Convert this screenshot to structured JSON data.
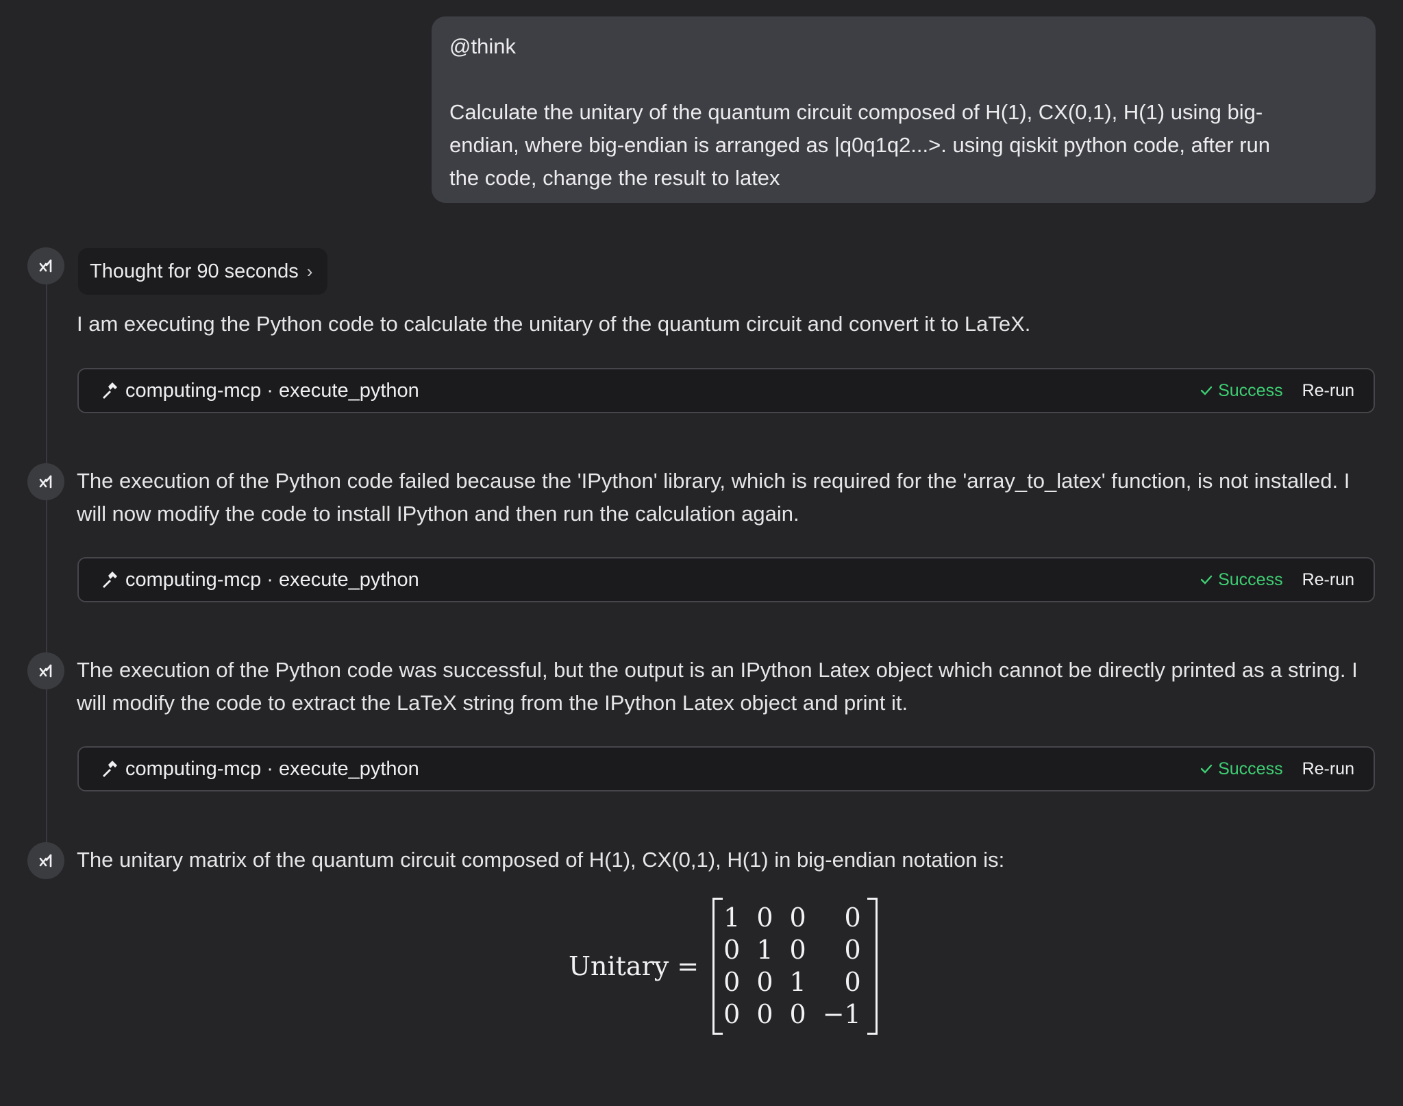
{
  "user_message": {
    "line1": "@think",
    "line2": "Calculate the unitary of the quantum circuit composed of H(1), CX(0,1), H(1) using big-",
    "line3": "endian, where big-endian is arranged as |q0q1q2...>.  using qiskit python code, after run",
    "line4": "the code, change the result to latex"
  },
  "thought": {
    "label": "Thought for 90 seconds",
    "chevron": "›"
  },
  "messages": [
    {
      "text": "I am executing the Python code to calculate the unitary of the quantum circuit and convert it to LaTeX."
    },
    {
      "text": "The execution of the Python code failed because the 'IPython' library, which is required for the 'array_to_latex' function, is not installed. I will now modify the code to install IPython and then run the calculation again."
    },
    {
      "text": "The execution of the Python code was successful, but the output is an IPython Latex object which cannot be directly printed as a string. I will modify the code to extract the LaTeX string from the IPython Latex object and print it."
    },
    {
      "text": "The unitary matrix of the quantum circuit composed of H(1), CX(0,1), H(1) in big-endian notation is:"
    }
  ],
  "tool_calls": [
    {
      "label": "computing-mcp · execute_python",
      "status": "Success",
      "action": "Re-run",
      "icon": "hammer-icon"
    },
    {
      "label": "computing-mcp · execute_python",
      "status": "Success",
      "action": "Re-run",
      "icon": "hammer-icon"
    },
    {
      "label": "computing-mcp · execute_python",
      "status": "Success",
      "action": "Re-run",
      "icon": "hammer-icon"
    }
  ],
  "result": {
    "label": "Unitary =",
    "matrix": [
      [
        "1",
        "0",
        "0",
        "0"
      ],
      [
        "0",
        "1",
        "0",
        "0"
      ],
      [
        "0",
        "0",
        "1",
        "0"
      ],
      [
        "0",
        "0",
        "0",
        "−1"
      ]
    ]
  },
  "colors": {
    "background": "#252527",
    "user_bubble": "#3e3f44",
    "tool_bar": "#1b1b1d",
    "success": "#3ecf73"
  }
}
